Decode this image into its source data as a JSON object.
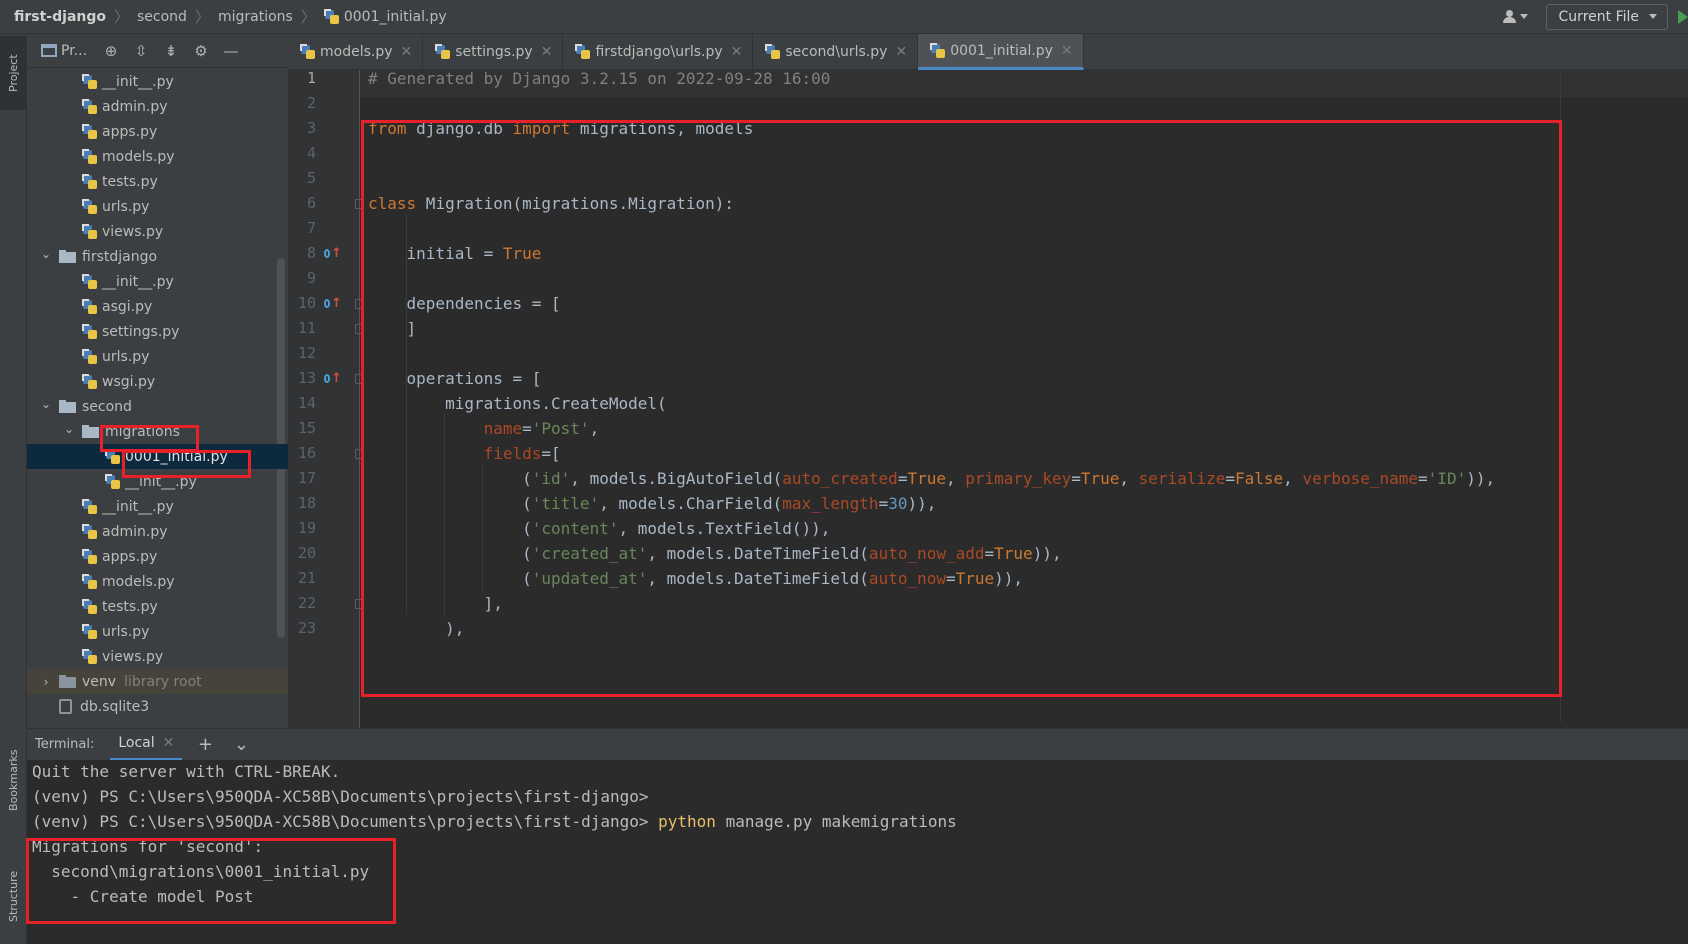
{
  "breadcrumbs": {
    "items": [
      "first-django",
      "second",
      "migrations"
    ],
    "file": "0001_initial.py"
  },
  "toolbar": {
    "run_config": "Current File"
  },
  "left_strip": {
    "project_tab": "Project",
    "bookmarks_tab": "Bookmarks",
    "structure_tab": "Structure"
  },
  "project_panel": {
    "title": "Pr...",
    "tree": [
      {
        "label": "__init__.py",
        "type": "py",
        "depth": 3
      },
      {
        "label": "admin.py",
        "type": "py",
        "depth": 3
      },
      {
        "label": "apps.py",
        "type": "py",
        "depth": 3
      },
      {
        "label": "models.py",
        "type": "py",
        "depth": 3
      },
      {
        "label": "tests.py",
        "type": "py",
        "depth": 3
      },
      {
        "label": "urls.py",
        "type": "py",
        "depth": 3
      },
      {
        "label": "views.py",
        "type": "py",
        "depth": 3
      },
      {
        "label": "firstdjango",
        "type": "folder",
        "depth": 2,
        "expanded": true
      },
      {
        "label": "__init__.py",
        "type": "py",
        "depth": 3
      },
      {
        "label": "asgi.py",
        "type": "py",
        "depth": 3
      },
      {
        "label": "settings.py",
        "type": "py",
        "depth": 3
      },
      {
        "label": "urls.py",
        "type": "py",
        "depth": 3
      },
      {
        "label": "wsgi.py",
        "type": "py",
        "depth": 3
      },
      {
        "label": "second",
        "type": "folder",
        "depth": 2,
        "expanded": true
      },
      {
        "label": "migrations",
        "type": "folder",
        "depth": 3,
        "expanded": true
      },
      {
        "label": "0001_initial.py",
        "type": "py",
        "depth": 4,
        "selected": true
      },
      {
        "label": "__init__.py",
        "type": "py",
        "depth": 4
      },
      {
        "label": "__init__.py",
        "type": "py",
        "depth": 3
      },
      {
        "label": "admin.py",
        "type": "py",
        "depth": 3
      },
      {
        "label": "apps.py",
        "type": "py",
        "depth": 3
      },
      {
        "label": "models.py",
        "type": "py",
        "depth": 3
      },
      {
        "label": "tests.py",
        "type": "py",
        "depth": 3
      },
      {
        "label": "urls.py",
        "type": "py",
        "depth": 3
      },
      {
        "label": "views.py",
        "type": "py",
        "depth": 3
      },
      {
        "label": "venv",
        "type": "folder",
        "depth": 2,
        "expanded": false,
        "note": "library root"
      },
      {
        "label": "db.sqlite3",
        "type": "db",
        "depth": 2
      }
    ]
  },
  "editor_tabs": [
    {
      "label": "models.py",
      "active": false
    },
    {
      "label": "settings.py",
      "active": false
    },
    {
      "label": "firstdjango\\urls.py",
      "active": false
    },
    {
      "label": "second\\urls.py",
      "active": false
    },
    {
      "label": "0001_initial.py",
      "active": true
    }
  ],
  "editor": {
    "line_numbers": [
      "1",
      "2",
      "3",
      "4",
      "5",
      "6",
      "7",
      "8",
      "9",
      "10",
      "11",
      "12",
      "13",
      "14",
      "15",
      "16",
      "17",
      "18",
      "19",
      "20",
      "21",
      "22",
      "23"
    ],
    "lines": [
      "# Generated by Django 3.2.15 on 2022-09-28 16:00",
      "",
      "from django.db import migrations, models",
      "",
      "",
      "class Migration(migrations.Migration):",
      "",
      "    initial = True",
      "",
      "    dependencies = [",
      "    ]",
      "",
      "    operations = [",
      "        migrations.CreateModel(",
      "            name='Post',",
      "            fields=[",
      "                ('id', models.BigAutoField(auto_created=True, primary_key=True, serialize=False, verbose_name='ID')),",
      "                ('title', models.CharField(max_length=30)),",
      "                ('content', models.TextField()),",
      "                ('created_at', models.DateTimeField(auto_now_add=True)),",
      "                ('updated_at', models.DateTimeField(auto_now=True)),",
      "            ],",
      "        ),"
    ]
  },
  "terminal": {
    "label": "Terminal:",
    "tab": "Local",
    "lines": [
      "Quit the server with CTRL-BREAK.",
      "(venv) PS C:\\Users\\950QDA-XC58B\\Documents\\projects\\first-django>",
      "(venv) PS C:\\Users\\950QDA-XC58B\\Documents\\projects\\first-django> python manage.py makemigrations",
      "Migrations for 'second':",
      "  second\\migrations\\0001_initial.py",
      "    - Create model Post"
    ]
  },
  "icons": {
    "user": "user-icon",
    "run": "run-icon",
    "locate": "crosshair-icon",
    "expand_all": "expand-all-icon",
    "collapse_all": "collapse-all-icon",
    "settings": "gear-icon",
    "hide": "minimize-icon",
    "new_terminal": "plus-icon",
    "terminal_options": "chevron-down-icon"
  },
  "colors": {
    "annotation": "#e8202a",
    "keyword": "#cc7832",
    "string": "#6a8759",
    "number": "#6897bb",
    "param": "#aa4926",
    "comment": "#808080"
  }
}
